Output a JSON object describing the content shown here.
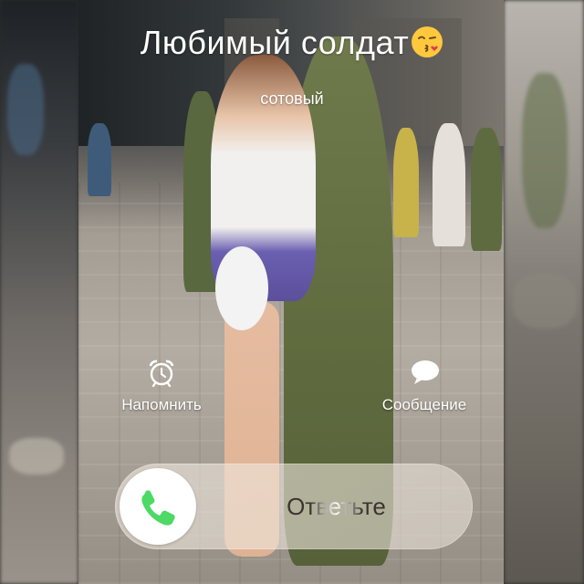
{
  "caller": {
    "name": "Любимый солдат",
    "subtitle": "сотовый",
    "emoji_icon": "kissing-face-emoji-icon"
  },
  "actions": {
    "remind": {
      "label": "Напомнить",
      "icon": "alarm-clock-icon"
    },
    "message": {
      "label": "Сообщение",
      "icon": "speech-bubble-icon"
    }
  },
  "answer_slider": {
    "label": "Ответьте",
    "icon": "phone-handset-icon",
    "accent_color": "#4cd964"
  }
}
